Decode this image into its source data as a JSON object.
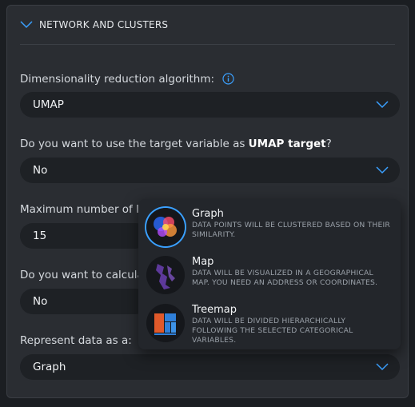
{
  "section": {
    "title": "NETWORK AND CLUSTERS"
  },
  "fields": {
    "algorithm_label": "Dimensionality reduction algorithm:",
    "algorithm_value": "UMAP",
    "target_label_prefix": "Do you want to use the target variable as ",
    "target_label_bold": "UMAP target",
    "target_label_suffix": "?",
    "target_value": "No",
    "links_label": "Maximum number of link",
    "links_value": "15",
    "calculate_label": "Do you want to calculate",
    "calculate_value": "No",
    "represent_label": "Represent data as a:",
    "represent_value": "Graph"
  },
  "popup": {
    "options": [
      {
        "title": "Graph",
        "description": "DATA POINTS WILL BE CLUSTERED BASED ON THEIR SIMILARITY.",
        "icon": "graph-thumbnail"
      },
      {
        "title": "Map",
        "description": "DATA WILL BE VISUALIZED IN A GEOGRAPHICAL MAP. YOU NEED AN ADDRESS OR COORDINATES.",
        "icon": "map-thumbnail"
      },
      {
        "title": "Treemap",
        "description": "DATA WILL BE DIVIDED HIERARCHICALLY FOLLOWING THE SELECTED CATEGORICAL VARIABLES.",
        "icon": "treemap-thumbnail"
      }
    ]
  },
  "colors": {
    "accent": "#3aa0ff",
    "panel": "#2a2d32",
    "field": "#1e2125"
  }
}
